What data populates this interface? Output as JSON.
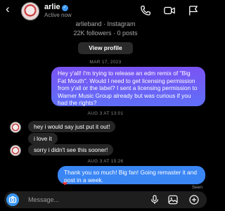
{
  "header": {
    "name": "arlie",
    "status": "Active now"
  },
  "profile_card": {
    "handle": "arlieband · Instagram",
    "stats": "22K followers · 0 posts",
    "view_profile_label": "View profile"
  },
  "messages": {
    "timestamp_1": "MAR 17, 2023",
    "outgoing_1": "Hey y'all! I'm trying to release an edm remix of \"Big Fat Mouth\". Would I need to get licensing permission from y'all or the label? I sent a licensing permission to Warner Music Group already but was curious if you had the rights?",
    "timestamp_2": "AUG 3 AT 13:01",
    "incoming_1": "hey i would say just put it out!",
    "incoming_2": "i love it",
    "incoming_3": "sorry i didn't see this sooner!",
    "timestamp_3": "AUG 3 AT 15:26",
    "outgoing_2": "Thank you so much! Big fan! Going remaster it and post in a week.",
    "reaction": "❤",
    "seen_label": "Seen"
  },
  "composer": {
    "placeholder": "Message..."
  },
  "icons": {
    "back": "chevron-left-icon",
    "call": "phone-icon",
    "video": "video-camera-icon",
    "flag": "flag-icon",
    "camera": "camera-icon",
    "mic": "microphone-icon",
    "gallery": "image-icon",
    "sticker": "plus-circle-icon"
  },
  "colors": {
    "accent": "#3897f0",
    "outgoing_bubble_top": "#7b53f3",
    "outgoing_bubble_bottom": "#5f6ff8",
    "incoming_bubble": "#262626"
  }
}
